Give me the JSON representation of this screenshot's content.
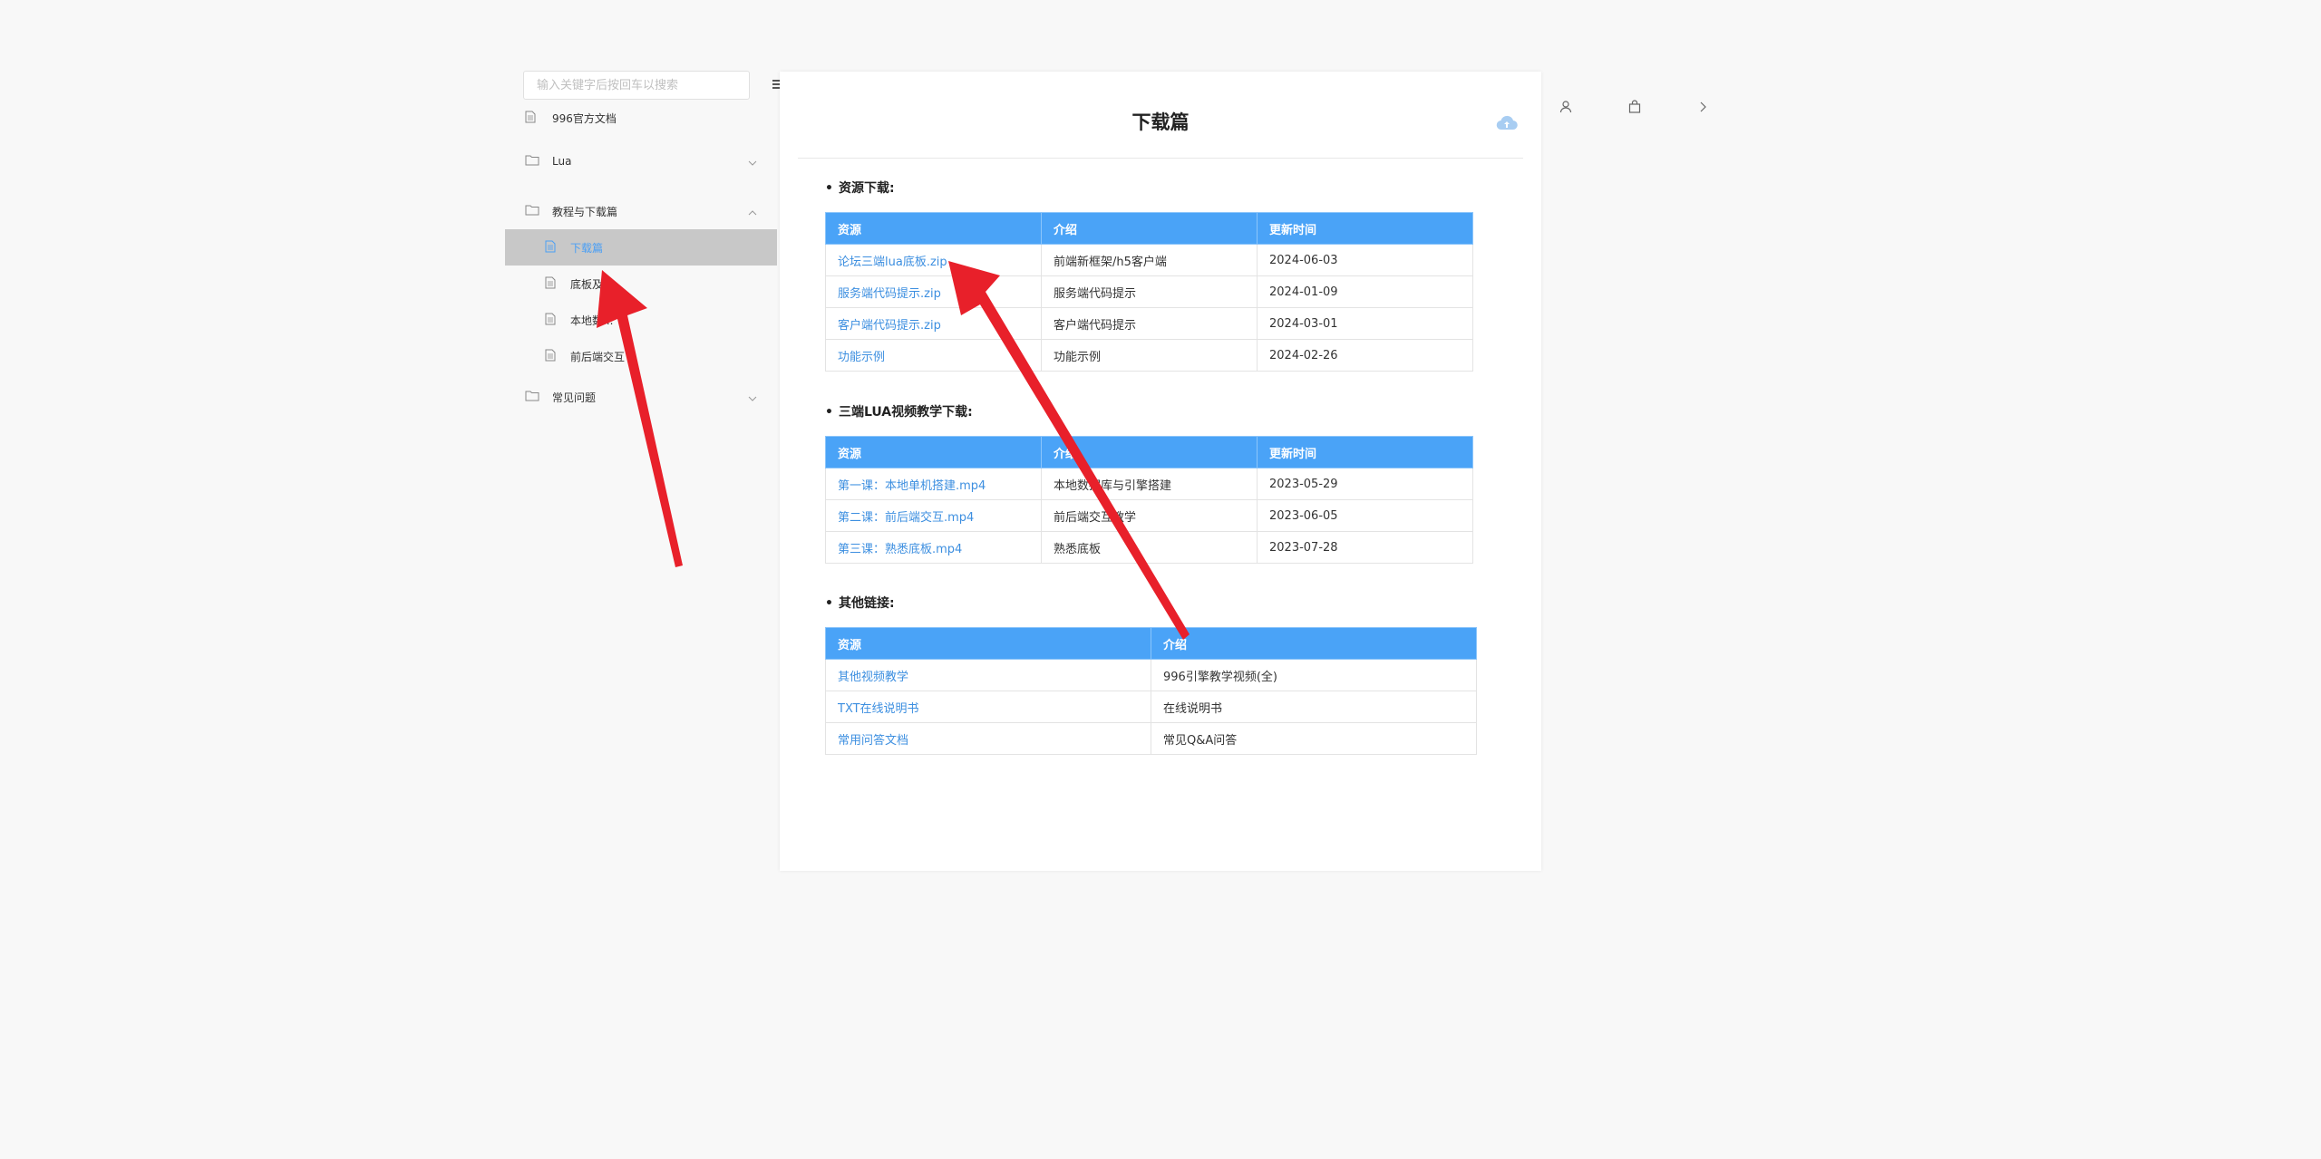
{
  "search": {
    "placeholder": "输入关键字后按回车以搜索"
  },
  "sidebar": {
    "items": [
      {
        "label": "996官方文档"
      },
      {
        "label": "Lua"
      },
      {
        "label": "教程与下载篇"
      },
      {
        "label": "下载篇"
      },
      {
        "label": "底板及....."
      },
      {
        "label": "本地数..."
      },
      {
        "label": "前后端交互"
      },
      {
        "label": "常见问题"
      }
    ]
  },
  "page": {
    "title": "下载篇"
  },
  "sections": [
    {
      "heading": "资源下载:",
      "headers": [
        "资源",
        "介绍",
        "更新时间"
      ],
      "rows": [
        [
          "论坛三端lua底板.zip",
          "前端新框架/h5客户端",
          "2024-06-03"
        ],
        [
          "服务端代码提示.zip",
          "服务端代码提示",
          "2024-01-09"
        ],
        [
          "客户端代码提示.zip",
          "客户端代码提示",
          "2024-03-01"
        ],
        [
          "功能示例",
          "功能示例",
          "2024-02-26"
        ]
      ]
    },
    {
      "heading": "三端LUA视频教学下载:",
      "headers": [
        "资源",
        "介绍",
        "更新时间"
      ],
      "rows": [
        [
          "第一课：本地单机搭建.mp4",
          "本地数据库与引擎搭建",
          "2023-05-29"
        ],
        [
          "第二课：前后端交互.mp4",
          "前后端交互教学",
          "2023-06-05"
        ],
        [
          "第三课：熟悉底板.mp4",
          "熟悉底板",
          "2023-07-28"
        ]
      ]
    },
    {
      "heading": "其他链接:",
      "headers": [
        "资源",
        "介绍"
      ],
      "rows": [
        [
          "其他视频教学",
          "996引擎教学视频(全)"
        ],
        [
          "TXT在线说明书",
          "在线说明书"
        ],
        [
          "常用问答文档",
          "常见Q&A问答"
        ]
      ]
    }
  ],
  "colors": {
    "header_blue": "#4aa3f7",
    "link_blue": "#3d8fe0",
    "arrow_red": "#e8202a",
    "active_bg": "#c8c8c8"
  },
  "icons": [
    "menu-icon",
    "file-icon",
    "folder-icon",
    "chevron-down-icon",
    "chevron-up-icon",
    "cloud-upload-icon",
    "user-icon",
    "bag-icon",
    "chevron-right-icon"
  ]
}
